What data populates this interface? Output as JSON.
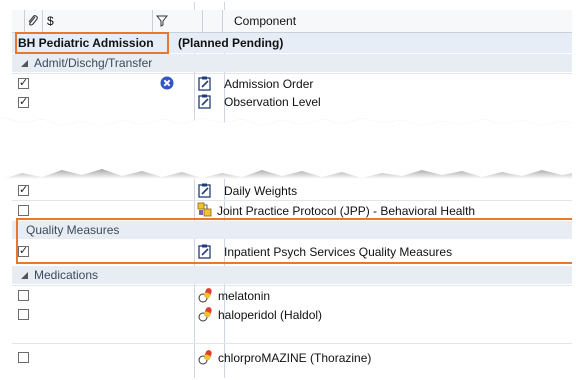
{
  "header": {
    "dollar": "$",
    "component": "Component"
  },
  "plan": {
    "name_part1": "BH Pediatric Admission",
    "name_part2": "(Planned Pending)"
  },
  "sections": {
    "admit": "Admit/Dischg/Transfer",
    "quality": "Quality Measures",
    "meds": "Medications"
  },
  "items": {
    "admission_order": "Admission Order",
    "observation_level": "Observation Level",
    "daily_weights": "Daily Weights",
    "jpp": "Joint Practice Protocol (JPP) - Behavioral Health",
    "quality_measures": "Inpatient Psych Services Quality Measures",
    "melatonin": "melatonin",
    "haloperidol": "haloperidol (Haldol)",
    "chlorpromazine": "chlorproMAZINE (Thorazine)"
  },
  "colors": {
    "highlight": "#e8782b",
    "group_bg": "#e8edf3",
    "error_icon": "#2f55c9"
  },
  "icons": {
    "attachment": "paperclip-icon",
    "filter": "filter-icon",
    "collapse": "collapse-triangle-icon",
    "order": "clipboard-pencil-icon",
    "protocol": "protocol-icon",
    "medication": "pill-icon",
    "error": "error-x-icon"
  }
}
